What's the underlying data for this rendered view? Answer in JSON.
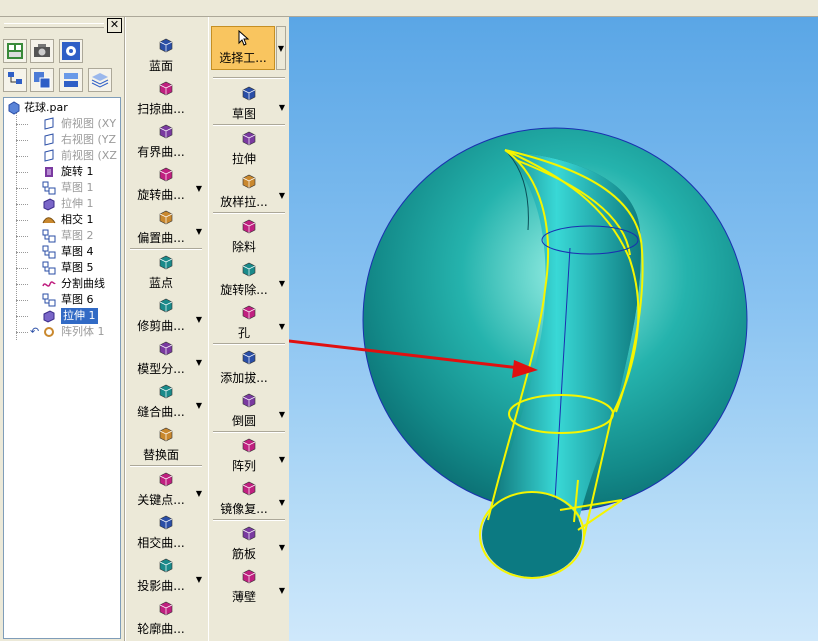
{
  "colors": {
    "accent_select": "#f9c55f",
    "selection_blue": "#316ac5",
    "sphere": "#1fa3a0",
    "edge_yellow": "#f5f500",
    "arrow_red": "#e01010"
  },
  "panel": {
    "close_label": "✕",
    "toolbar_icons": [
      "feature-view-icon",
      "camera-icon",
      "settings-icon",
      "hierarchy-icon",
      "layers-icon",
      "parts-icon",
      "stack-icon"
    ]
  },
  "tree": {
    "root": "花球.par",
    "items": [
      {
        "label": "俯视图 (XY",
        "state": "dim",
        "icon": "plane-icon"
      },
      {
        "label": "右视图 (YZ",
        "state": "dim",
        "icon": "plane-icon"
      },
      {
        "label": "前视图 (XZ",
        "state": "dim",
        "icon": "plane-icon"
      },
      {
        "label": "旋转 1",
        "state": "normal",
        "icon": "revolve-icon"
      },
      {
        "label": "草图 1",
        "state": "dim",
        "icon": "sketch-icon"
      },
      {
        "label": "拉伸 1",
        "state": "dim",
        "icon": "extrude-icon"
      },
      {
        "label": "相交 1",
        "state": "normal",
        "icon": "intersect-icon"
      },
      {
        "label": "草图 2",
        "state": "dim",
        "icon": "sketch-icon"
      },
      {
        "label": "草图 4",
        "state": "normal",
        "icon": "sketch-icon"
      },
      {
        "label": "草图 5",
        "state": "normal",
        "icon": "sketch-icon"
      },
      {
        "label": "分割曲线",
        "state": "normal",
        "icon": "split-curve-icon"
      },
      {
        "label": "草图 6",
        "state": "normal",
        "icon": "sketch-icon"
      },
      {
        "label": "拉伸 1",
        "state": "selected",
        "icon": "extrude-icon"
      },
      {
        "label": "阵列体 1",
        "state": "dim",
        "icon": "pattern-icon"
      }
    ]
  },
  "surfacing_commands": [
    {
      "label": "蓝面",
      "icon": "bluesurf-icon",
      "dropdown": false
    },
    {
      "label": "扫掠曲...",
      "icon": "swept-icon",
      "dropdown": false
    },
    {
      "label": "有界曲...",
      "icon": "bounded-icon",
      "dropdown": false
    },
    {
      "label": "旋转曲...",
      "icon": "revolved-surface-icon",
      "dropdown": true
    },
    {
      "label": "偏置曲...",
      "icon": "offset-icon",
      "dropdown": true
    },
    {
      "label": "蓝点",
      "icon": "bluedot-icon",
      "dropdown": false
    },
    {
      "label": "修剪曲...",
      "icon": "trim-icon",
      "dropdown": true
    },
    {
      "label": "模型分...",
      "icon": "split-model-icon",
      "dropdown": true
    },
    {
      "label": "缝合曲...",
      "icon": "stitch-icon",
      "dropdown": true
    },
    {
      "label": "替换面",
      "icon": "replace-face-icon",
      "dropdown": false
    },
    {
      "label": "关键点...",
      "icon": "keypoint-icon",
      "dropdown": true
    },
    {
      "label": "相交曲...",
      "icon": "intersect-curve-icon",
      "dropdown": false
    },
    {
      "label": "投影曲...",
      "icon": "project-curve-icon",
      "dropdown": true
    },
    {
      "label": "轮廓曲...",
      "icon": "contour-curve-icon",
      "dropdown": false
    }
  ],
  "feature_commands": {
    "select_label": "选择工...",
    "items": [
      {
        "label": "草图",
        "icon": "sketch-icon",
        "dropdown": true
      },
      {
        "label": "拉伸",
        "icon": "protrusion-icon",
        "dropdown": false
      },
      {
        "label": "放样拉...",
        "icon": "loft-icon",
        "dropdown": true
      },
      {
        "label": "除料",
        "icon": "cutout-icon",
        "dropdown": false
      },
      {
        "label": "旋转除...",
        "icon": "revolved-cut-icon",
        "dropdown": true
      },
      {
        "label": "孔",
        "icon": "hole-icon",
        "dropdown": true
      },
      {
        "label": "添加拔...",
        "icon": "draft-icon",
        "dropdown": false
      },
      {
        "label": "倒圆",
        "icon": "round-icon",
        "dropdown": true
      },
      {
        "label": "阵列",
        "icon": "pattern-icon",
        "dropdown": true
      },
      {
        "label": "镜像复...",
        "icon": "mirror-icon",
        "dropdown": true
      },
      {
        "label": "筋板",
        "icon": "rib-icon",
        "dropdown": true
      },
      {
        "label": "薄壁",
        "icon": "thinwall-icon",
        "dropdown": true
      }
    ]
  }
}
